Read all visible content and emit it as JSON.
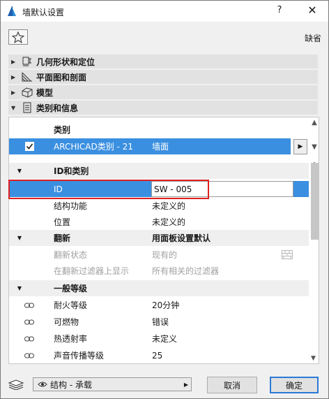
{
  "window": {
    "title": "墙默认设置",
    "help": "?",
    "close": "✕"
  },
  "toolbar": {
    "default_label": "缺省"
  },
  "sections": [
    {
      "label": "几何形状和定位",
      "expanded": false
    },
    {
      "label": "平面图和剖面",
      "expanded": false
    },
    {
      "label": "模型",
      "expanded": false
    },
    {
      "label": "类别和信息",
      "expanded": true
    }
  ],
  "category": {
    "header": "类别",
    "selected": {
      "name": "ARCHICAD类别 - 21",
      "value": "墙面",
      "checked": true
    }
  },
  "properties": {
    "group_id": "ID和类别",
    "id_label": "ID",
    "id_value": "SW - 005",
    "structural_function_label": "结构功能",
    "structural_function_value": "未定义的",
    "position_label": "位置",
    "position_value": "未定义的",
    "renovation_group": "翻新",
    "renovation_group_value": "用面板设置默认",
    "renovation_status_label": "翻新状态",
    "renovation_status_value": "现有的",
    "show_on_filter_label": "在翻新过滤器上显示",
    "show_on_filter_value": "所有相关的过滤器",
    "general_group": "一般等级",
    "fire_rating_label": "耐火等级",
    "fire_rating_value": "20分钟",
    "combustible_label": "可燃物",
    "combustible_value": "错误",
    "thermal_label": "热透射率",
    "thermal_value": "未定义",
    "acoustic_label": "声音传播等级",
    "acoustic_value": "25"
  },
  "footer": {
    "layer": "结构 - 承载",
    "cancel_label": "取消",
    "ok_label": "确定"
  },
  "colors": {
    "selection": "#3b8fe0",
    "highlight_box": "#e02020",
    "ok_border": "#2b7ad6"
  }
}
